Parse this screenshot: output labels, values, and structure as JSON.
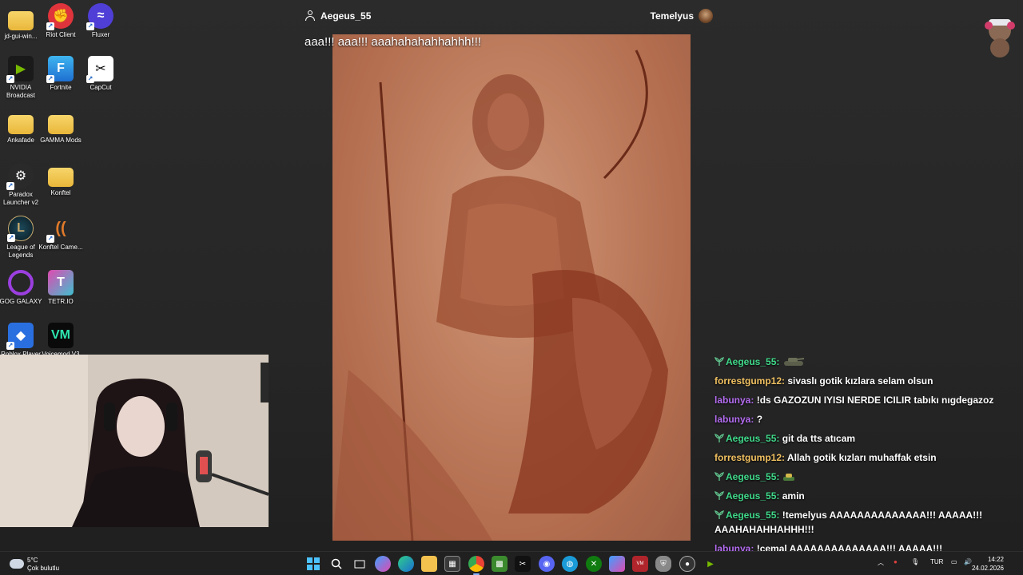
{
  "desktop": {
    "icons": [
      {
        "label": "jd-gui-win...",
        "icon": "folder-icon"
      },
      {
        "label": "Riot Client",
        "icon": "riot-client-icon"
      },
      {
        "label": "Fluxer",
        "icon": "fluxer-icon"
      },
      {
        "label": "NVIDIA Broadcast",
        "icon": "nvidia-broadcast-icon"
      },
      {
        "label": "Fortnite",
        "icon": "fortnite-icon"
      },
      {
        "label": "CapCut",
        "icon": "capcut-icon"
      },
      {
        "label": "Ankafade",
        "icon": "folder-icon"
      },
      {
        "label": "GAMMA Mods",
        "icon": "folder-icon"
      },
      {
        "label": "Paradox Launcher v2",
        "icon": "paradox-launcher-icon"
      },
      {
        "label": "Konftel",
        "icon": "folder-icon"
      },
      {
        "label": "League of Legends",
        "icon": "league-of-legends-icon"
      },
      {
        "label": "Konftel Came...",
        "icon": "konftel-camera-icon"
      },
      {
        "label": "GOG GALAXY",
        "icon": "gog-galaxy-icon"
      },
      {
        "label": "TETR.IO",
        "icon": "tetrio-icon"
      },
      {
        "label": "Roblox Player",
        "icon": "roblox-icon"
      },
      {
        "label": "Voicemod V3",
        "icon": "voicemod-icon"
      }
    ]
  },
  "stream": {
    "host_name": "Aegeus_55",
    "streamer_name": "Temelyus",
    "tts_message": "aaa!!! aaa!!! aaahahahahhahhh!!!"
  },
  "chat": {
    "messages": [
      {
        "user": "Aegeus_55",
        "color": "#3fd98a",
        "badge": true,
        "text": "",
        "emote": "tank-emote"
      },
      {
        "user": "forrestgump12",
        "color": "#f0c060",
        "badge": false,
        "text": "sivaslı gotik kızlara selam olsun"
      },
      {
        "user": "labunya",
        "color": "#b36cf0",
        "badge": false,
        "text": "!ds GAZOZUN IYISI NERDE ICILIR tabıkı nıgdegazoz"
      },
      {
        "user": "labunya",
        "color": "#b36cf0",
        "badge": false,
        "text": "?"
      },
      {
        "user": "Aegeus_55",
        "color": "#3fd98a",
        "badge": true,
        "text": "git da tts atıcam"
      },
      {
        "user": "forrestgump12",
        "color": "#f0c060",
        "badge": false,
        "text": "Allah gotik kızları muhaffak etsin"
      },
      {
        "user": "Aegeus_55",
        "color": "#3fd98a",
        "badge": true,
        "text": "",
        "emote": "small-tank-emote"
      },
      {
        "user": "Aegeus_55",
        "color": "#3fd98a",
        "badge": true,
        "text": "amin"
      },
      {
        "user": "Aegeus_55",
        "color": "#3fd98a",
        "badge": true,
        "text": "!temelyus AAAAAAAAAAAAAA!!! AAAAA!!! AAAHAHAHHAHHH!!!"
      },
      {
        "user": "labunya",
        "color": "#b36cf0",
        "badge": false,
        "text": "!cemal AAAAAAAAAAAAAA!!! AAAAA!!! AAAHAHAHHAHHH!!!"
      }
    ]
  },
  "taskbar": {
    "weather_temp": "5°C",
    "weather_condition": "Çok bulutlu",
    "language": "TUR",
    "time": "14:22",
    "date": "24.02.2026",
    "apps": [
      "start-icon",
      "search-icon",
      "task-view-icon",
      "copilot-icon",
      "edge-icon",
      "file-explorer-icon",
      "store-icon",
      "chrome-icon",
      "minecraft-icon",
      "capcut-icon",
      "discord-icon",
      "browser-icon",
      "xbox-icon",
      "phone-link-icon",
      "voicemeeter-icon",
      "shield-icon",
      "obs-icon",
      "nvidia-icon"
    ]
  }
}
